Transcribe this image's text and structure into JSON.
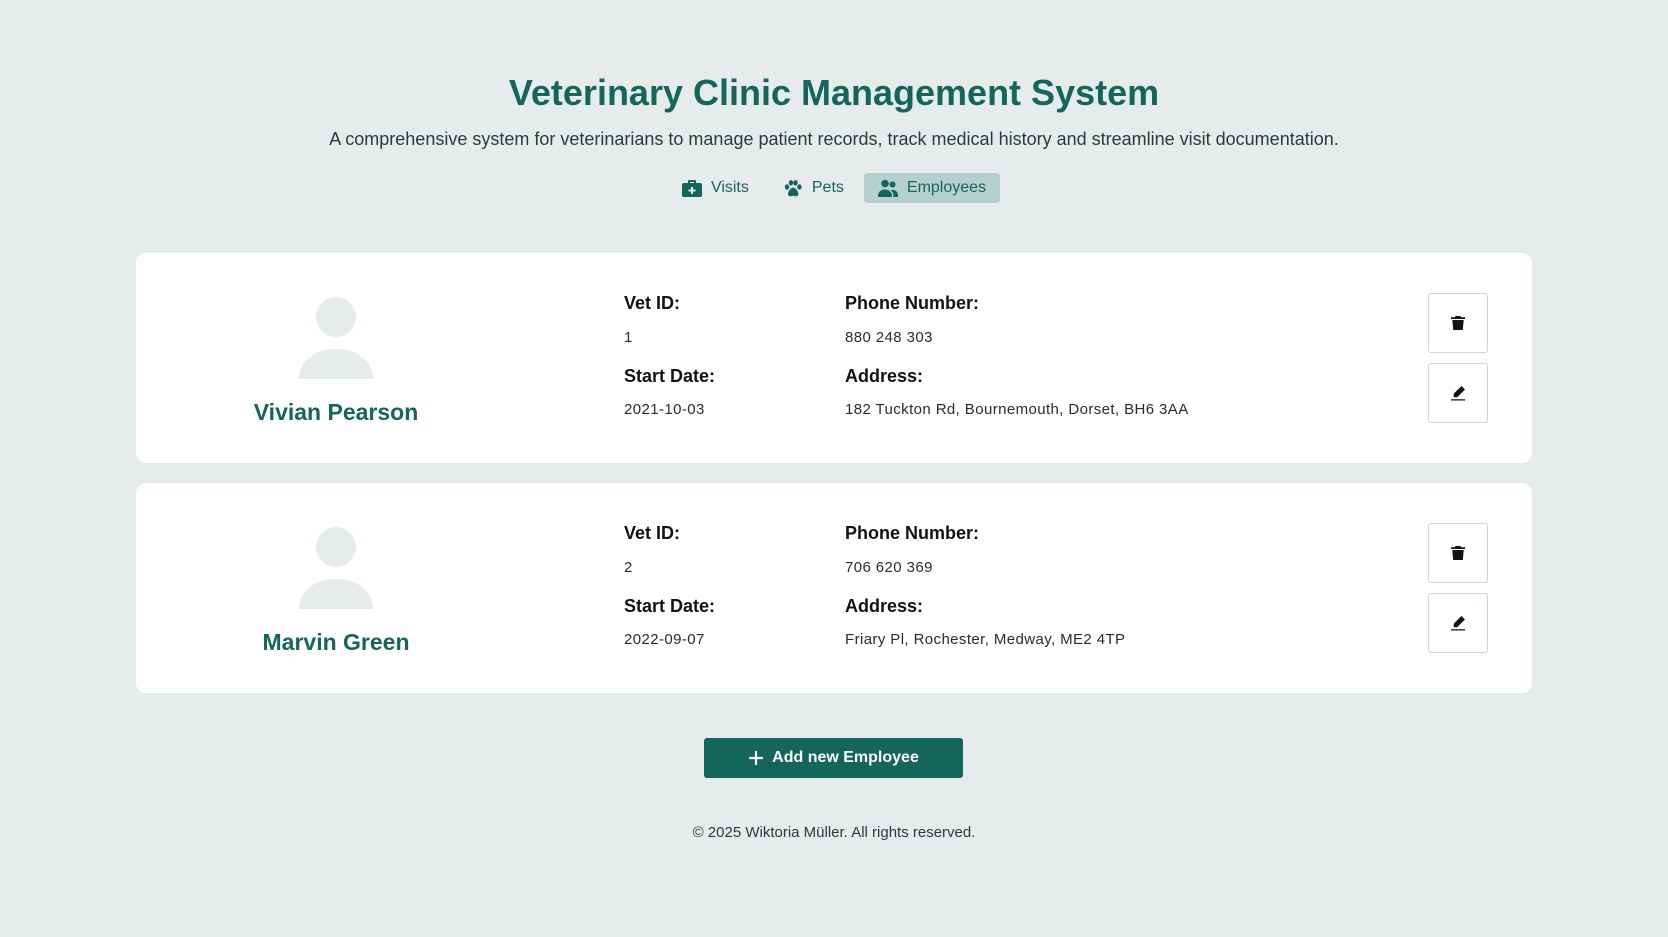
{
  "header": {
    "title": "Veterinary Clinic Management System",
    "subtitle": "A comprehensive system for veterinarians to manage patient records, track medical history and streamline visit documentation."
  },
  "tabs": [
    {
      "label": "Visits",
      "icon": "medical-kit-icon",
      "active": false
    },
    {
      "label": "Pets",
      "icon": "paw-icon",
      "active": false
    },
    {
      "label": "Employees",
      "icon": "users-icon",
      "active": true
    }
  ],
  "labels": {
    "vet_id": "Vet ID:",
    "phone": "Phone Number:",
    "start_date": "Start Date:",
    "address": "Address:"
  },
  "employees": [
    {
      "name": "Vivian Pearson",
      "vet_id": "1",
      "phone": "880 248 303",
      "start_date": "2021-10-03",
      "address": "182 Tuckton Rd, Bournemouth, Dorset, BH6 3AA"
    },
    {
      "name": "Marvin Green",
      "vet_id": "2",
      "phone": "706 620 369",
      "start_date": "2022-09-07",
      "address": "Friary Pl, Rochester, Medway, ME2 4TP"
    }
  ],
  "actions": {
    "add_label": "Add new Employee"
  },
  "footer": {
    "text": "© 2025 Wiktoria Müller. All rights reserved."
  },
  "colors": {
    "background": "#e6ecec",
    "primary": "#12665a",
    "active_tab": "#b5d1ce",
    "card": "#ffffff",
    "avatar": "#e6ecec"
  }
}
